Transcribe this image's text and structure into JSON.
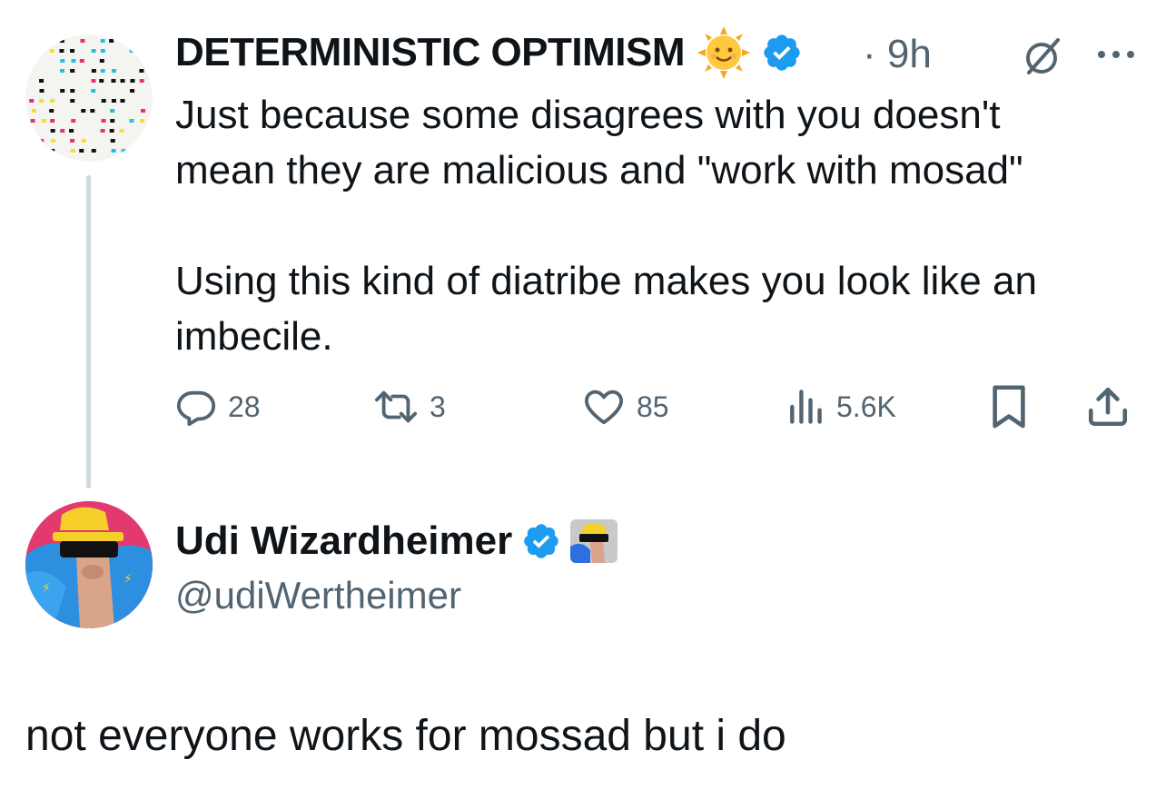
{
  "tweet1": {
    "display_name": "DETERMINISTIC OPTIMISM",
    "name_emoji": "sun-with-face",
    "verified": true,
    "timestamp": "· 9h",
    "text_line1": "Just because some disagrees with you doesn't",
    "text_line2": "mean they are malicious and \"work with mosad\"",
    "text_line3": "Using this kind of diatribe makes you look like an",
    "text_line4": "imbecile.",
    "actions": {
      "replies": "28",
      "reposts": "3",
      "likes": "85",
      "views": "5.6K"
    }
  },
  "tweet2": {
    "display_name": "Udi Wizardheimer",
    "verified": true,
    "handle": "@udiWertheimer",
    "text": "not everyone works for mossad but i do"
  },
  "colors": {
    "text": "#0f1419",
    "secondary": "#536471",
    "verified_blue": "#1d9bf0",
    "thread_line": "#cfd9de"
  }
}
